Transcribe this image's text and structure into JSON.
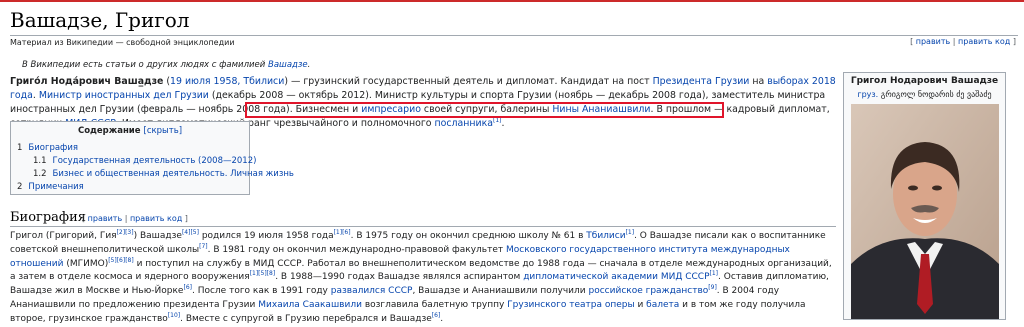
{
  "page": {
    "title": "Вашадзе, Григол",
    "tagline": "Материал из Википедии — свободной энциклопедии",
    "edit_top": {
      "open": "[ ",
      "edit": "править",
      "sep": " | ",
      "edit_code": "править код",
      "close": " ]"
    }
  },
  "hatnote": {
    "text": "В Википедии есть статьи о других людях с фамилией ",
    "link": "Вашадзе",
    "end": "."
  },
  "lead": {
    "name": "Григо́л Нода́рович Вашa̲дзе",
    "born_link": "19 июля 1958, Тбилиси",
    "t1": " — грузинский государственный деятель и дипломат. Кандидат на пост ",
    "l1": "Президента Грузии",
    "t2": " на ",
    "l2": "выборах 2018 года",
    "t3": ". ",
    "l3": "Министр иностранных дел Грузии",
    "t4": " (декабрь 2008 — октябрь 2012). Министр культуры и спорта Грузии (ноябрь — декабрь 2008 года), заместитель министра иностранных дел Грузии (февраль — ноябрь 2008 года). Бизнесмен и ",
    "l4": "импресарио",
    "t5": " своей супруги, балерины ",
    "l5": "Нины Ананиашвили",
    "t6": ". В прошлом — ",
    "t7": "кадровый дипломат, сотрудник ",
    "l6": "МИД СССР",
    "t8": ". Имеет дипломатический ранг чрезвычайного и полномочного ",
    "l7": "посланника",
    "ref": "[1]",
    "t9": "."
  },
  "toc": {
    "title": "Содержание",
    "toggle": "[скрыть]",
    "items": [
      {
        "num": "1",
        "label": "Биография"
      },
      {
        "num": "1.1",
        "label": "Государственная деятельность (2008—2012)"
      },
      {
        "num": "1.2",
        "label": "Бизнес и общественная деятельность. Личная жизнь"
      },
      {
        "num": "2",
        "label": "Примечания"
      }
    ]
  },
  "section": {
    "title": "Биография",
    "edit": {
      "open": "[ ",
      "edit": "править",
      "sep": " | ",
      "edit_code": "править код",
      "close": " ]"
    }
  },
  "bio": {
    "a1": "Григол (Григорий, Гия",
    "r1": "[2][3]",
    "a2": ") Вашадзе",
    "r2": "[4][5]",
    "a3": " родился 19 июля 1958 года",
    "r3": "[1][6]",
    "a4": ". В 1975 году он окончил среднюю школу № 61 в ",
    "l1": "Тбилиси",
    "r4": "[1]",
    "a5": ". О Вашадзе писали как о воспитаннике советской внешнеполитической школы",
    "r5": "[7]",
    "a6": ". В 1981 году он окончил международно-правовой факультет ",
    "l2": "Московского государственного института международных отношений",
    "a7": " (МГИМО)",
    "r6": "[5][6][8]",
    "a8": " и поступил на службу в МИД СССР. Работал во внешнеполитическом ведомстве до 1988 года — сначала в отделе международных организаций, а затем в отделе космоса и ядерного вооружения",
    "r7": "[1][5][8]",
    "a9": ". В 1988—1990 годах Вашадзе являлся аспирантом ",
    "l3": "дипломатической академии МИД СССР",
    "r8": "[1]",
    "a10": ". Оставив дипломатию, Вашадзе жил в Москве и Нью-Йорке",
    "r9": "[6]",
    "a11": ". После того как в 1991 году ",
    "l4": "развалился СССР",
    "a12": ", Вашадзе и Ананиашвили получили ",
    "l5": "российское гражданство",
    "r10": "[9]",
    "a13": ". В 2004 году Ананиашвили по предложению президента Грузии ",
    "l6": "Михаила Саакашвили",
    "a14": " возглавила балетную труппу ",
    "l7": "Грузинского театра оперы",
    "a15": " и ",
    "l8": "балета",
    "a16": " и в том же году получила второе, грузинское гражданство",
    "r11": "[10]",
    "a17": ". Вместе с супругой в Грузию перебрался и Вашадзе",
    "r12": "[6]",
    "a18": "."
  },
  "infobox": {
    "title": "Григол Нодарович Вашадзе",
    "sub_link": "груз.",
    "sub_text": " გრიგოლ ნოდარის ძე ვაშაძე"
  },
  "colors": {
    "highlight": "#e0152b",
    "link": "#0645ad",
    "top_line": "#cc2a2a"
  }
}
